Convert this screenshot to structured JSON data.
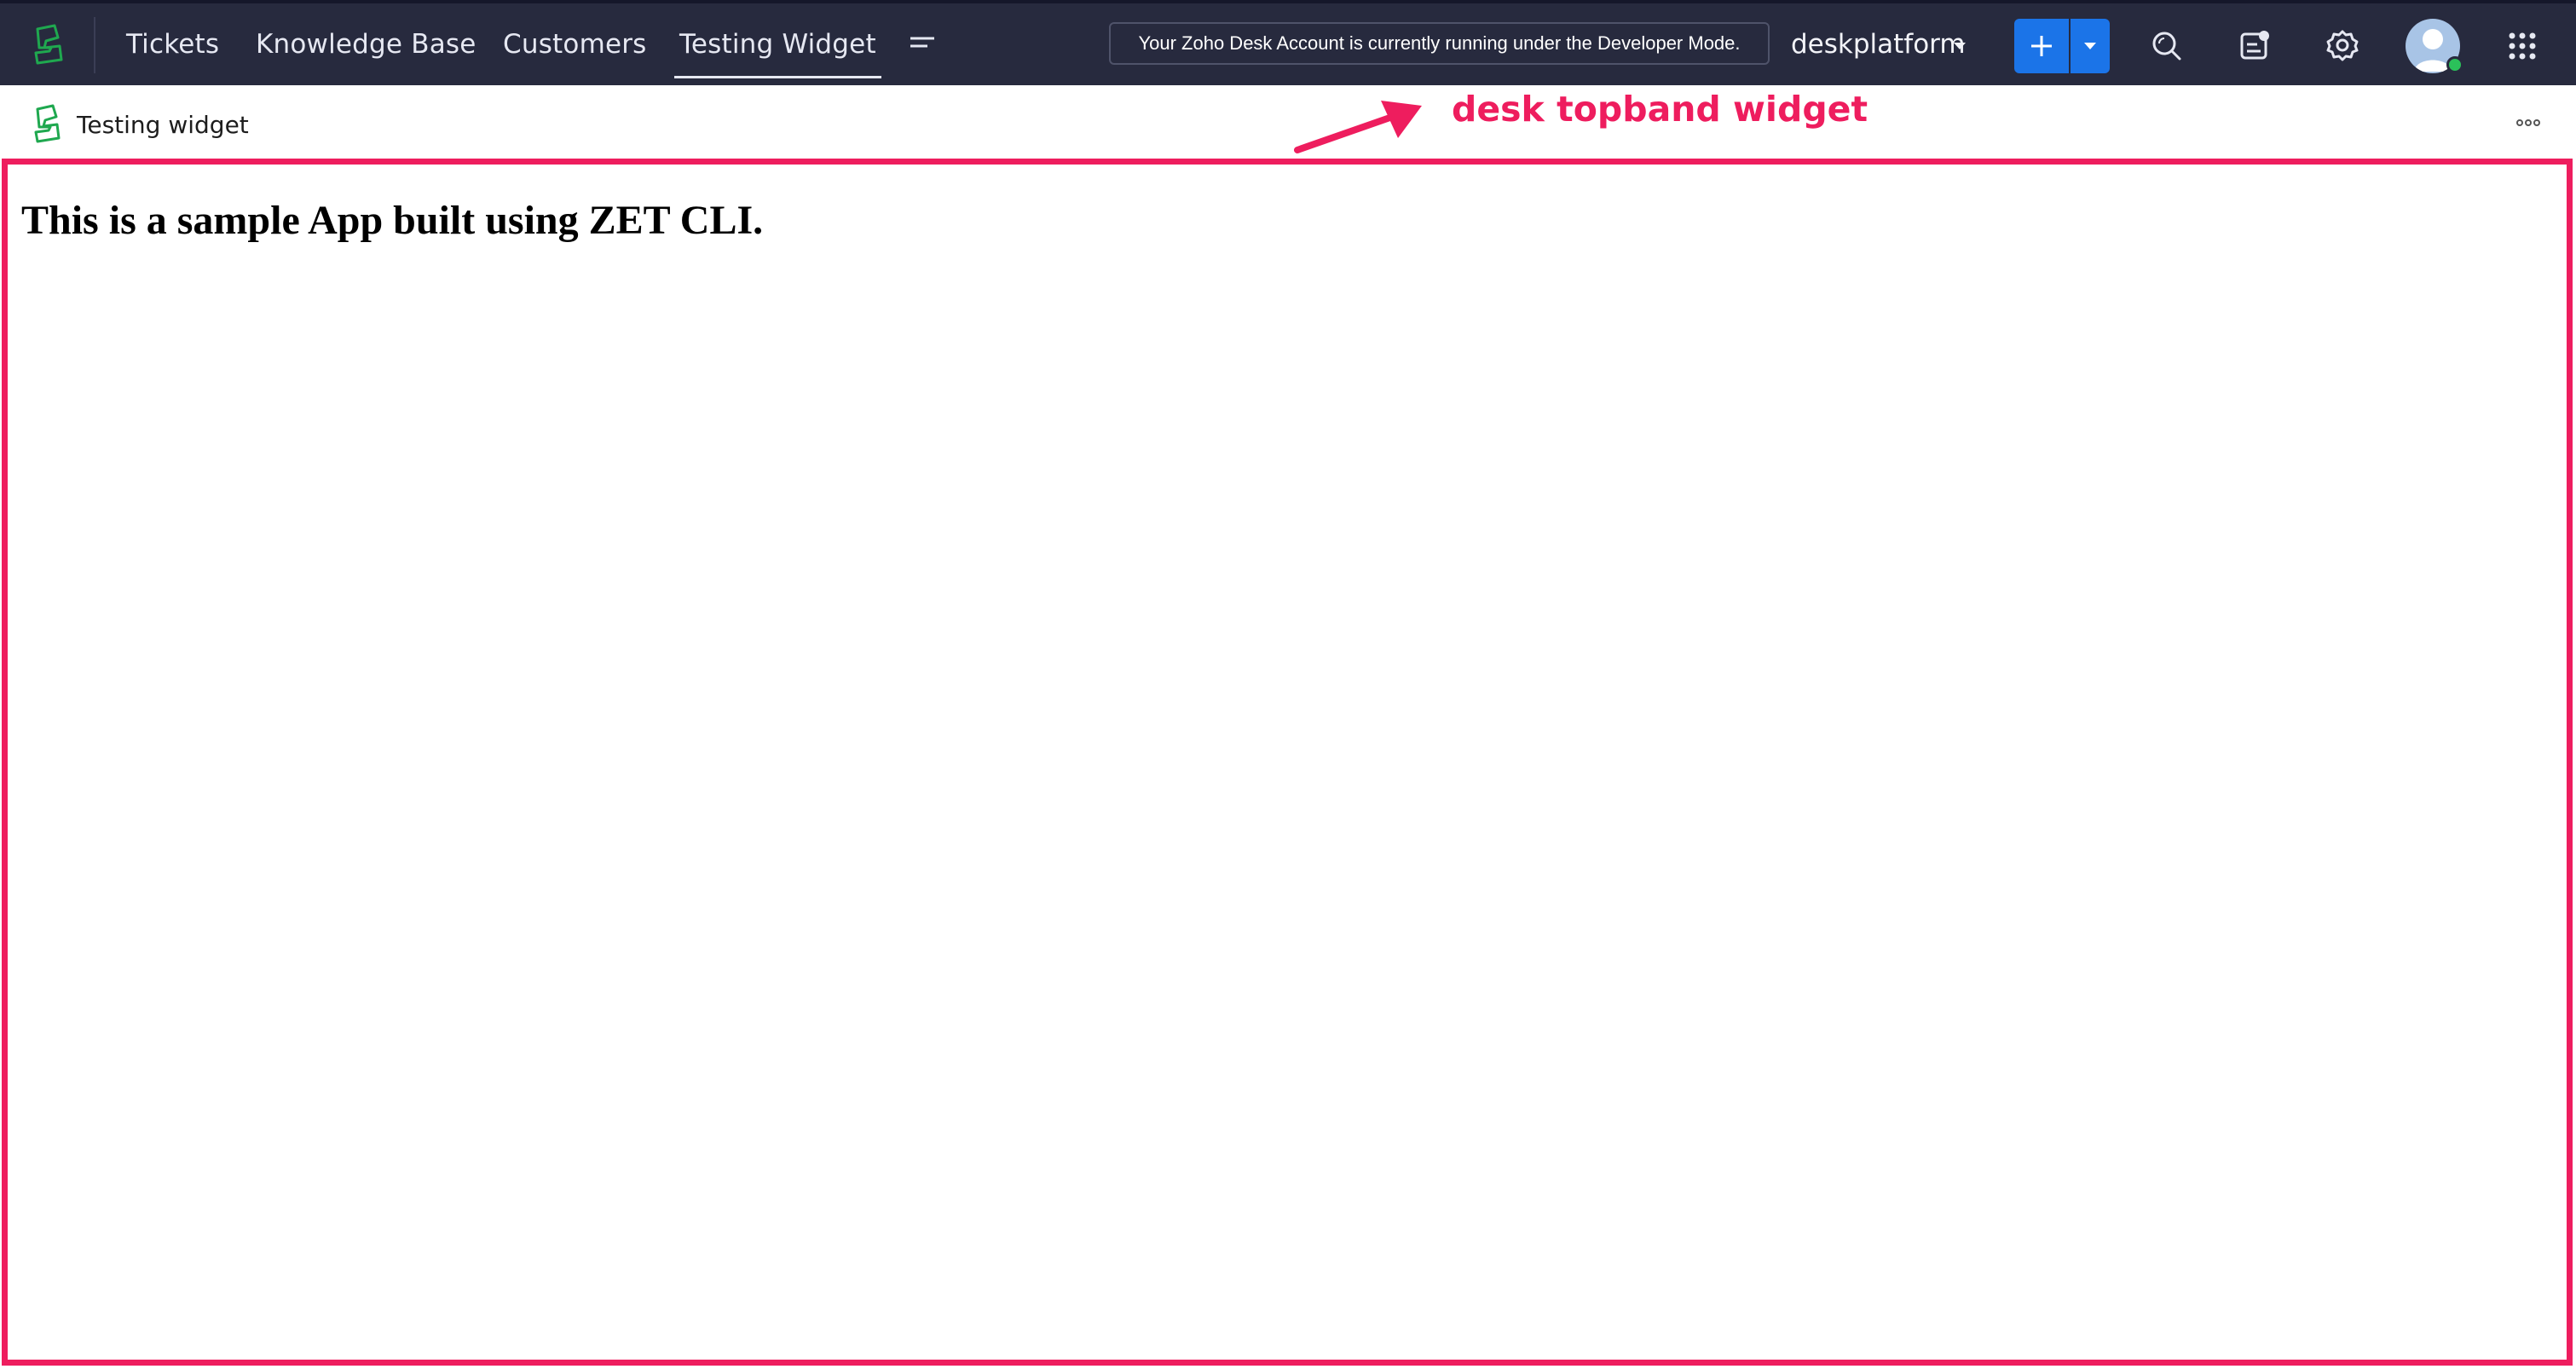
{
  "colors": {
    "topbar_bg": "#272a3e",
    "accent_blue": "#1b74e8",
    "annotation_pink": "#ee1d5e",
    "logo_green": "#1fa84f"
  },
  "nav": {
    "tabs": [
      {
        "label": "Tickets"
      },
      {
        "label": "Knowledge Base"
      },
      {
        "label": "Customers"
      },
      {
        "label": "Testing Widget",
        "active": true
      }
    ],
    "more_icon": "hamburger-menu-icon"
  },
  "banner": {
    "text": "Your Zoho Desk Account is currently running under the Developer Mode."
  },
  "portal": {
    "name": "deskplatform"
  },
  "toolbar": {
    "add_icon": "plus-icon",
    "icons": [
      "search-icon",
      "feed-icon",
      "gear-icon",
      "avatar",
      "apps-grid-icon"
    ]
  },
  "widget": {
    "title": "Testing widget",
    "annotation": "desk topband widget",
    "body_heading": "This is a sample App built using ZET CLI."
  }
}
